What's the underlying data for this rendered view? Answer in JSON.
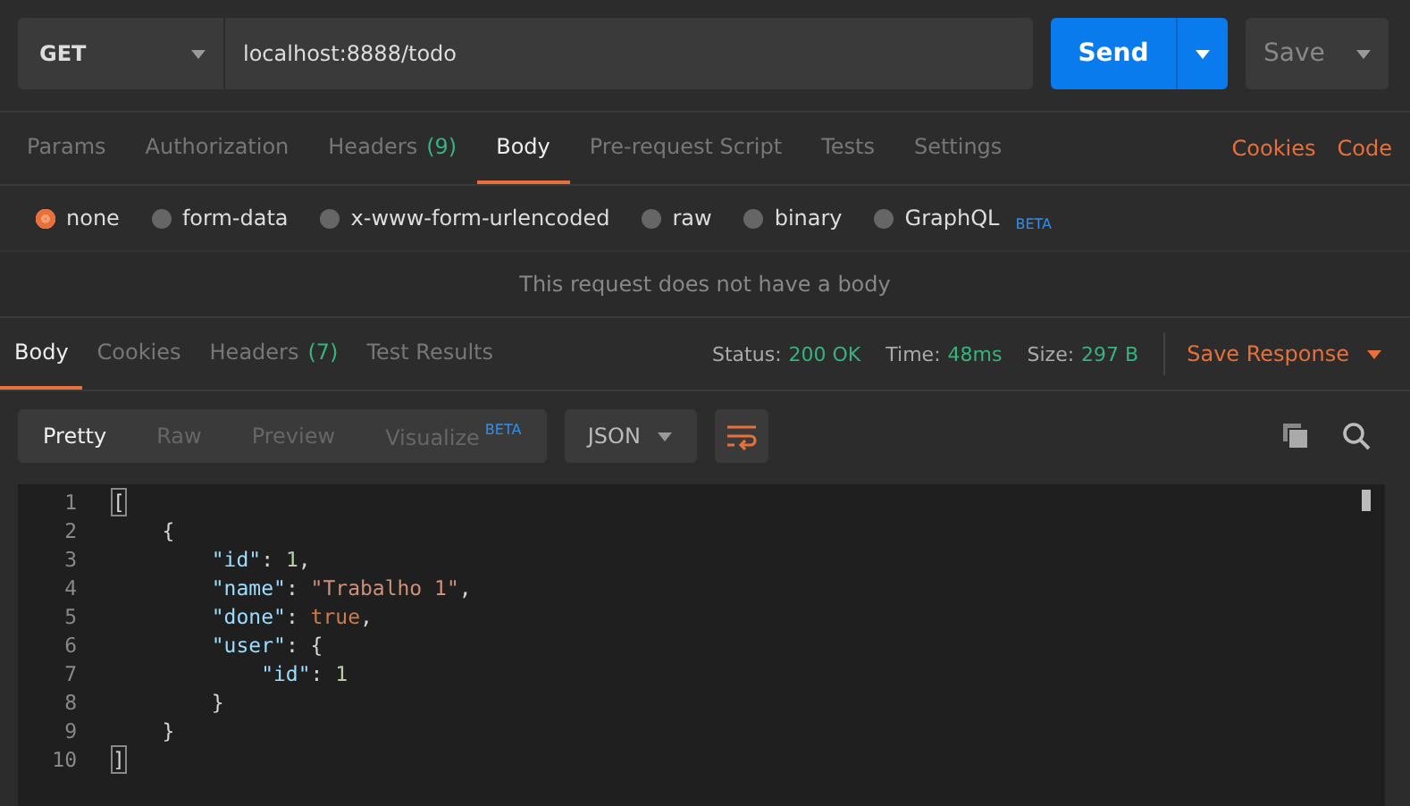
{
  "request": {
    "method": "GET",
    "url": "localhost:8888/todo",
    "send": "Send",
    "save": "Save"
  },
  "request_tabs": [
    {
      "label": "Params",
      "selected": false
    },
    {
      "label": "Authorization",
      "selected": false
    },
    {
      "label": "Headers",
      "count": "(9)",
      "selected": false
    },
    {
      "label": "Body",
      "selected": true
    },
    {
      "label": "Pre-request Script",
      "selected": false
    },
    {
      "label": "Tests",
      "selected": false
    },
    {
      "label": "Settings",
      "selected": false
    }
  ],
  "request_links": [
    "Cookies",
    "Code"
  ],
  "body_types": [
    {
      "label": "none",
      "selected": true
    },
    {
      "label": "form-data",
      "selected": false
    },
    {
      "label": "x-www-form-urlencoded",
      "selected": false
    },
    {
      "label": "raw",
      "selected": false
    },
    {
      "label": "binary",
      "selected": false
    },
    {
      "label": "GraphQL",
      "badge": "BETA",
      "selected": false
    }
  ],
  "body_message": "This request does not have a body",
  "response_tabs": [
    {
      "label": "Body",
      "selected": true
    },
    {
      "label": "Cookies",
      "selected": false
    },
    {
      "label": "Headers",
      "count": "(7)",
      "selected": false
    },
    {
      "label": "Test Results",
      "selected": false
    }
  ],
  "status": [
    {
      "label": "Status:",
      "value": "200 OK"
    },
    {
      "label": "Time:",
      "value": "48ms"
    },
    {
      "label": "Size:",
      "value": "297 B"
    }
  ],
  "save_response": "Save Response",
  "view_modes": [
    {
      "label": "Pretty",
      "selected": true
    },
    {
      "label": "Raw",
      "selected": false
    },
    {
      "label": "Preview",
      "selected": false
    },
    {
      "label": "Visualize",
      "badge": "BETA",
      "selected": false
    }
  ],
  "format": "JSON",
  "code_lines": [
    {
      "number": "1",
      "tokens": [
        {
          "kind": "bracket",
          "text": "["
        }
      ]
    },
    {
      "number": "2",
      "tokens": [
        {
          "kind": "punct",
          "text": "    {"
        }
      ]
    },
    {
      "number": "3",
      "tokens": [
        {
          "kind": "key",
          "text": "        \"id\""
        },
        {
          "kind": "punct",
          "text": ": "
        },
        {
          "kind": "number",
          "text": "1"
        },
        {
          "kind": "punct",
          "text": ","
        }
      ]
    },
    {
      "number": "4",
      "tokens": [
        {
          "kind": "key",
          "text": "        \"name\""
        },
        {
          "kind": "punct",
          "text": ": "
        },
        {
          "kind": "string",
          "text": "\"Trabalho 1\""
        },
        {
          "kind": "punct",
          "text": ","
        }
      ]
    },
    {
      "number": "5",
      "tokens": [
        {
          "kind": "key",
          "text": "        \"done\""
        },
        {
          "kind": "punct",
          "text": ": "
        },
        {
          "kind": "bool",
          "text": "true"
        },
        {
          "kind": "punct",
          "text": ","
        }
      ]
    },
    {
      "number": "6",
      "tokens": [
        {
          "kind": "key",
          "text": "        \"user\""
        },
        {
          "kind": "punct",
          "text": ": {"
        }
      ]
    },
    {
      "number": "7",
      "tokens": [
        {
          "kind": "key",
          "text": "            \"id\""
        },
        {
          "kind": "punct",
          "text": ": "
        },
        {
          "kind": "number",
          "text": "1"
        }
      ]
    },
    {
      "number": "8",
      "tokens": [
        {
          "kind": "punct",
          "text": "        }"
        }
      ]
    },
    {
      "number": "9",
      "tokens": [
        {
          "kind": "punct",
          "text": "    }"
        }
      ]
    },
    {
      "number": "10",
      "tokens": [
        {
          "kind": "bracket",
          "text": "]"
        }
      ]
    }
  ]
}
